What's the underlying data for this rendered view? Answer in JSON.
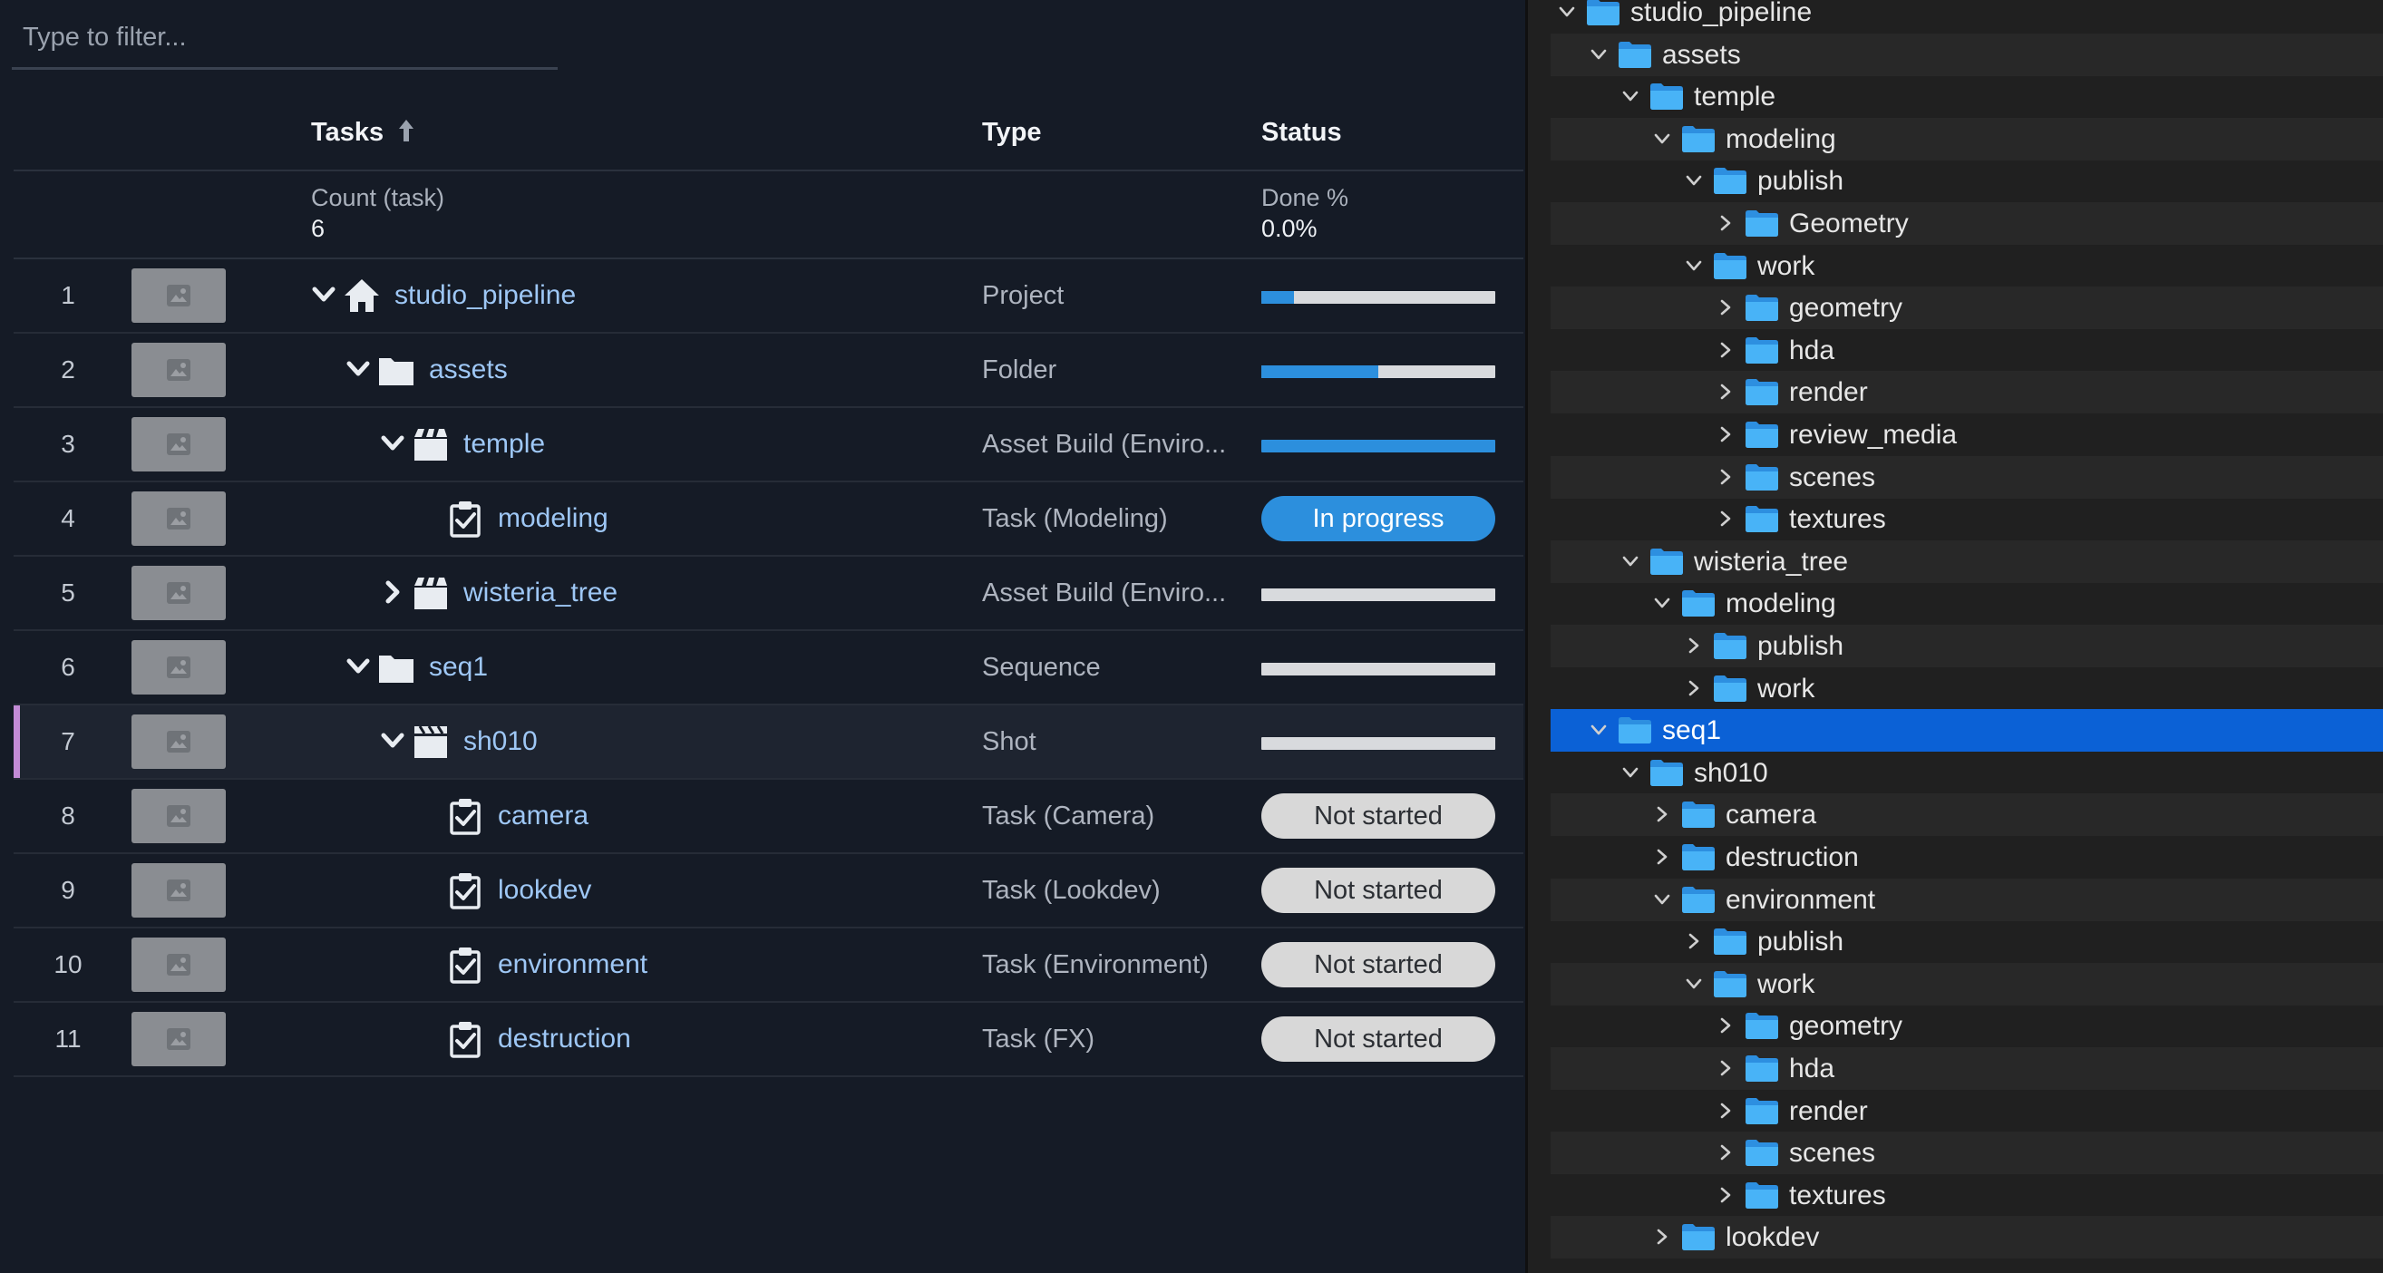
{
  "filter": {
    "placeholder": "Type to filter..."
  },
  "columns": {
    "tasks": "Tasks",
    "type": "Type",
    "status": "Status",
    "sort_icon": "arrow-up-icon"
  },
  "summary": {
    "count_label": "Count (task)",
    "count_value": "6",
    "done_label": "Done %",
    "done_value": "0.0%"
  },
  "rows": [
    {
      "num": "1",
      "name": "studio_pipeline",
      "type": "Project",
      "icon": "home-icon",
      "expander": "chevron-down",
      "progress": 0.14
    },
    {
      "num": "2",
      "name": "assets",
      "type": "Folder",
      "icon": "folder-icon",
      "expander": "chevron-down",
      "progress": 0.5
    },
    {
      "num": "3",
      "name": "temple",
      "type": "Asset Build (Enviro...",
      "icon": "asset-build-icon",
      "expander": "chevron-down",
      "progress": 1.0
    },
    {
      "num": "4",
      "name": "modeling",
      "type": "Task (Modeling)",
      "icon": "task-icon",
      "status": "In progress"
    },
    {
      "num": "5",
      "name": "wisteria_tree",
      "type": "Asset Build (Enviro...",
      "icon": "asset-build-icon",
      "expander": "chevron-right",
      "progress": 0.0
    },
    {
      "num": "6",
      "name": "seq1",
      "type": "Sequence",
      "icon": "folder-icon",
      "expander": "chevron-down",
      "progress": 0.0
    },
    {
      "num": "7",
      "name": "sh010",
      "type": "Shot",
      "icon": "clapperboard-icon",
      "expander": "chevron-down",
      "progress": 0.0,
      "selected": true
    },
    {
      "num": "8",
      "name": "camera",
      "type": "Task (Camera)",
      "icon": "task-icon",
      "status": "Not started"
    },
    {
      "num": "9",
      "name": "lookdev",
      "type": "Task (Lookdev)",
      "icon": "task-icon",
      "status": "Not started"
    },
    {
      "num": "10",
      "name": "environment",
      "type": "Task (Environment)",
      "icon": "task-icon",
      "status": "Not started"
    },
    {
      "num": "11",
      "name": "destruction",
      "type": "Task (FX)",
      "icon": "task-icon",
      "status": "Not started"
    }
  ],
  "file_tree": [
    {
      "label": "studio_pipeline",
      "depth": 0,
      "expanded": true
    },
    {
      "label": "assets",
      "depth": 1,
      "expanded": true
    },
    {
      "label": "temple",
      "depth": 2,
      "expanded": true
    },
    {
      "label": "modeling",
      "depth": 3,
      "expanded": true
    },
    {
      "label": "publish",
      "depth": 4,
      "expanded": true
    },
    {
      "label": "Geometry",
      "depth": 5,
      "expanded": false
    },
    {
      "label": "work",
      "depth": 4,
      "expanded": true
    },
    {
      "label": "geometry",
      "depth": 5,
      "expanded": false
    },
    {
      "label": "hda",
      "depth": 5,
      "expanded": false
    },
    {
      "label": "render",
      "depth": 5,
      "expanded": false
    },
    {
      "label": "review_media",
      "depth": 5,
      "expanded": false
    },
    {
      "label": "scenes",
      "depth": 5,
      "expanded": false
    },
    {
      "label": "textures",
      "depth": 5,
      "expanded": false
    },
    {
      "label": "wisteria_tree",
      "depth": 2,
      "expanded": true
    },
    {
      "label": "modeling",
      "depth": 3,
      "expanded": true
    },
    {
      "label": "publish",
      "depth": 4,
      "expanded": false
    },
    {
      "label": "work",
      "depth": 4,
      "expanded": false
    },
    {
      "label": "seq1",
      "depth": 1,
      "expanded": true,
      "selected": true
    },
    {
      "label": "sh010",
      "depth": 2,
      "expanded": true
    },
    {
      "label": "camera",
      "depth": 3,
      "expanded": false
    },
    {
      "label": "destruction",
      "depth": 3,
      "expanded": false
    },
    {
      "label": "environment",
      "depth": 3,
      "expanded": true
    },
    {
      "label": "publish",
      "depth": 4,
      "expanded": false
    },
    {
      "label": "work",
      "depth": 4,
      "expanded": true
    },
    {
      "label": "geometry",
      "depth": 5,
      "expanded": false
    },
    {
      "label": "hda",
      "depth": 5,
      "expanded": false
    },
    {
      "label": "render",
      "depth": 5,
      "expanded": false
    },
    {
      "label": "scenes",
      "depth": 5,
      "expanded": false
    },
    {
      "label": "textures",
      "depth": 5,
      "expanded": false
    },
    {
      "label": "lookdev",
      "depth": 3,
      "expanded": false
    }
  ],
  "colors": {
    "accent": "#2c8fdd",
    "link": "#9ec7f5",
    "tree_selection": "#0b61d6",
    "folder": "#3aa8f2",
    "selection_marker": "#c38bd6"
  }
}
